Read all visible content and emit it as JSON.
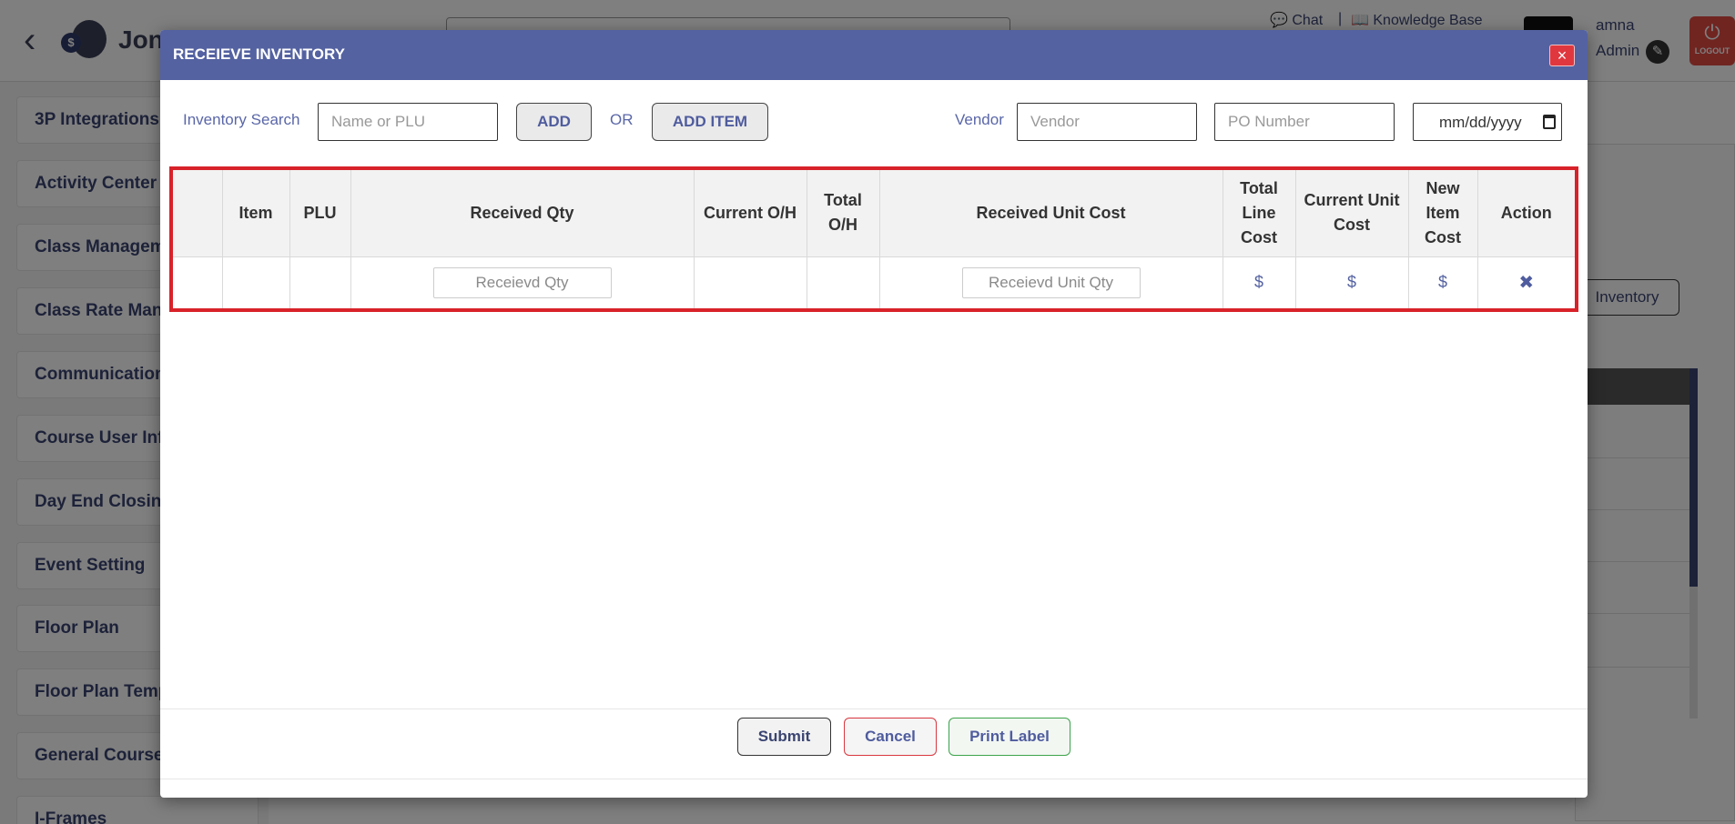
{
  "app": {
    "brand": "Jon",
    "logo_letter": "$",
    "chat": "Chat",
    "separator": "|",
    "knowledge_base": "Knowledge Base",
    "user_name": "amna",
    "user_role": "Admin",
    "logout": "LOGOUT"
  },
  "sidebar": {
    "items": [
      {
        "label": "3P Integrations"
      },
      {
        "label": "Activity Center"
      },
      {
        "label": "Class Managem"
      },
      {
        "label": "Class Rate Man"
      },
      {
        "label": "Communication"
      },
      {
        "label": "Course User Info"
      },
      {
        "label": "Day End Closing"
      },
      {
        "label": "Event Setting"
      },
      {
        "label": "Floor Plan"
      },
      {
        "label": "Floor Plan Temp"
      },
      {
        "label": "General Course"
      },
      {
        "label": "I-Frames"
      }
    ]
  },
  "background": {
    "inventory_button": "Inventory"
  },
  "modal": {
    "title": "RECEIEVE INVENTORY",
    "close_icon": "×",
    "inventory_search_label": "Inventory Search",
    "search_placeholder": "Name or PLU",
    "add_button": "ADD",
    "or_label": "OR",
    "add_item_button": "ADD ITEM",
    "vendor_label": "Vendor",
    "vendor_placeholder": "Vendor",
    "po_placeholder": "PO Number",
    "date_placeholder": "mm/dd/yyyy",
    "table": {
      "headers": [
        "",
        "Item",
        "PLU",
        "Received Qty",
        "Current O/H",
        "Total O/H",
        "Received Unit Cost",
        "Total Line Cost",
        "Current Unit Cost",
        "New Item Cost",
        "Action"
      ],
      "row": {
        "received_qty_placeholder": "Receievd Qty",
        "received_unit_cost_placeholder": "Receievd Unit Qty",
        "total_line_cost": "$",
        "current_unit_cost": "$",
        "new_item_cost": "$",
        "action_icon": "✖"
      }
    },
    "footer": {
      "submit": "Submit",
      "cancel": "Cancel",
      "print_label": "Print Label"
    }
  },
  "colors": {
    "header": "#5462a1",
    "highlight": "#d8222a",
    "close": "#e0373f",
    "logout": "#e04a43"
  }
}
